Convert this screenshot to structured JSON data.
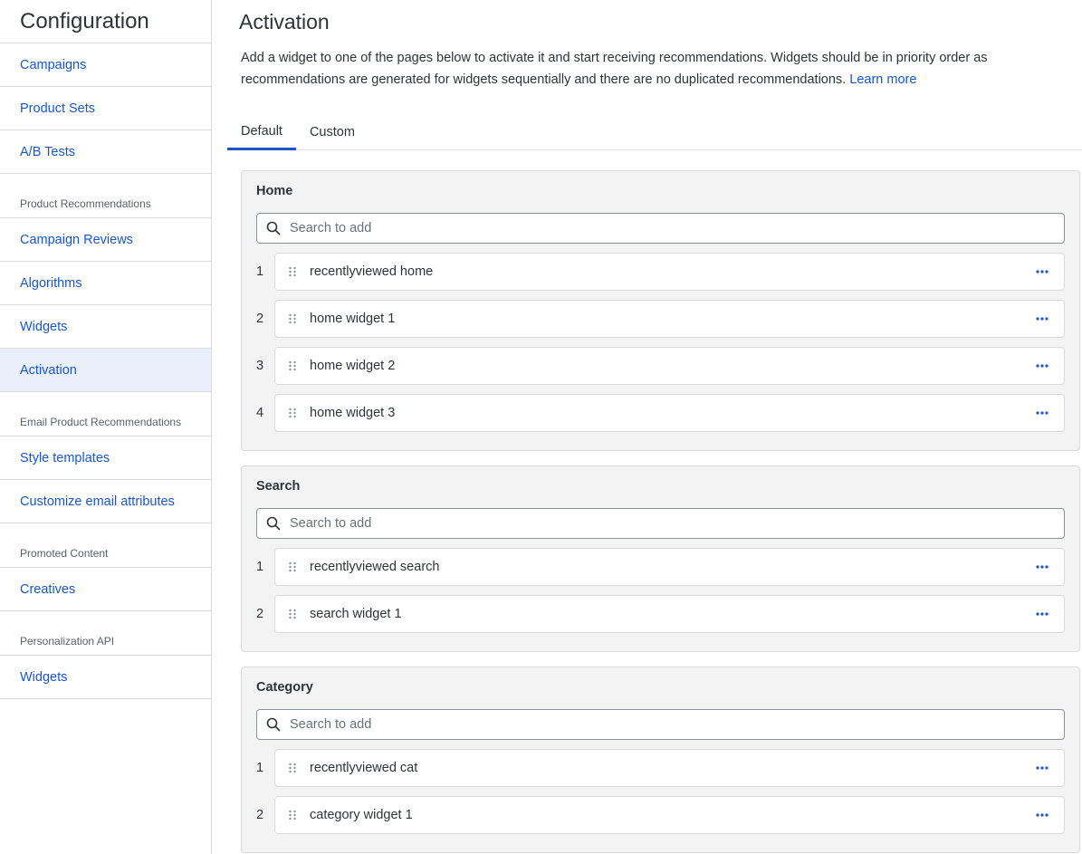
{
  "sidebar": {
    "title": "Configuration",
    "top_items": [
      {
        "label": "Campaigns"
      },
      {
        "label": "Product Sets"
      },
      {
        "label": "A/B Tests"
      }
    ],
    "sections": [
      {
        "heading": "Product Recommendations",
        "items": [
          {
            "label": "Campaign Reviews"
          },
          {
            "label": "Algorithms"
          },
          {
            "label": "Widgets"
          },
          {
            "label": "Activation"
          }
        ]
      },
      {
        "heading": "Email Product Recommendations",
        "items": [
          {
            "label": "Style templates"
          },
          {
            "label": "Customize email attributes"
          }
        ]
      },
      {
        "heading": "Promoted Content",
        "items": [
          {
            "label": "Creatives"
          }
        ]
      },
      {
        "heading": "Personalization API",
        "items": [
          {
            "label": "Widgets"
          }
        ]
      }
    ],
    "active_item": "Activation"
  },
  "main": {
    "title": "Activation",
    "description": "Add a widget to one of the pages below to activate it and start receiving recommendations. Widgets should be in priority order as recommendations are generated for widgets sequentially and there are no duplicated recommendations.",
    "learn_more": "Learn more",
    "tabs": [
      {
        "label": "Default"
      },
      {
        "label": "Custom"
      }
    ],
    "active_tab": "Default",
    "search_placeholder": "Search to add",
    "pages": [
      {
        "title": "Home",
        "widgets": [
          {
            "num": "1",
            "label": "recentlyviewed home"
          },
          {
            "num": "2",
            "label": "home widget 1"
          },
          {
            "num": "3",
            "label": "home widget 2"
          },
          {
            "num": "4",
            "label": "home widget 3"
          }
        ]
      },
      {
        "title": "Search",
        "widgets": [
          {
            "num": "1",
            "label": "recentlyviewed search"
          },
          {
            "num": "2",
            "label": "search widget 1"
          }
        ]
      },
      {
        "title": "Category",
        "widgets": [
          {
            "num": "1",
            "label": "recentlyviewed cat"
          },
          {
            "num": "2",
            "label": "category widget 1"
          }
        ]
      }
    ]
  },
  "colors": {
    "accent": "#1a56c8",
    "active_bg": "#eaf0fb",
    "card_bg": "#f3f3f4"
  }
}
